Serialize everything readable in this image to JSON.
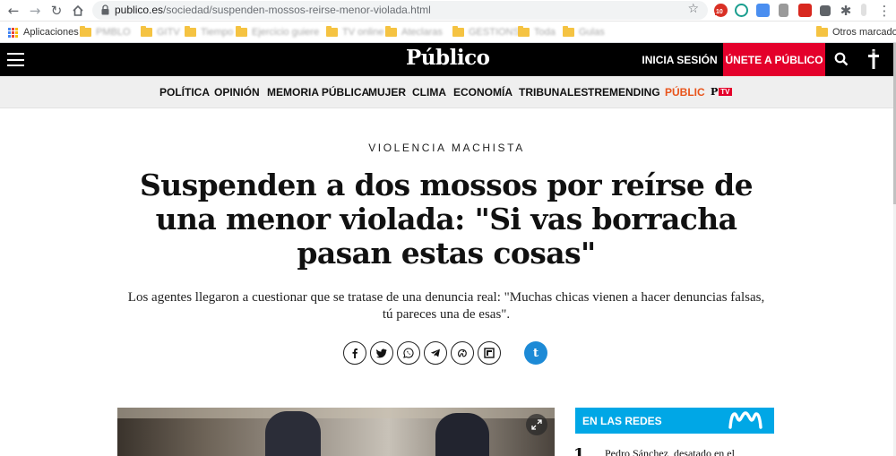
{
  "browser": {
    "url_host": "publico.es",
    "url_path": "/sociedad/suspenden-mossos-reirse-menor-violada.html",
    "ext_badge": "10",
    "bookmarks": {
      "apps_label": "Aplicaciones",
      "blurred_items": [
        "PMBLO",
        "GITV",
        "Tiempo",
        "Ejercicio guiere",
        "TV online",
        "Ateclaras",
        "GESTIONS",
        "Toda",
        "Gulas"
      ],
      "other_label": "Otros marcadores"
    }
  },
  "header": {
    "logo": "Público",
    "login_label": "INICIA SESIÓN",
    "join_label": "ÚNETE A PÚBLICO"
  },
  "nav": {
    "items": [
      "POLÍTICA",
      "OPINIÓN",
      "MEMORIA PÚBLICA",
      "MUJER",
      "CLIMA",
      "ECONOMÍA",
      "TRIBUNALES",
      "TREMENDING",
      "PÚBLIC"
    ],
    "ptv_p": "P",
    "ptv_tv": "TV"
  },
  "article": {
    "kicker": "VIOLENCIA MACHISTA",
    "headline": "Suspenden a dos mossos por reírse de una menor violada: \"Si vas borracha pasan estas cosas\"",
    "subtitle": "Los agentes llegaron a cuestionar que se tratase de una denuncia real: \"Muchas chicas vienen a hacer denuncias falsas, tú pareces una de esas\".",
    "brand_share_glyph": "t"
  },
  "sidebar": {
    "section_label": "EN LAS REDES",
    "first_rank": "1",
    "first_title": "Pedro Sánchez, desatado en el"
  },
  "colors": {
    "accent_red": "#e4002b",
    "nav_orange": "#e8541b",
    "redes_blue": "#00a7e6"
  }
}
